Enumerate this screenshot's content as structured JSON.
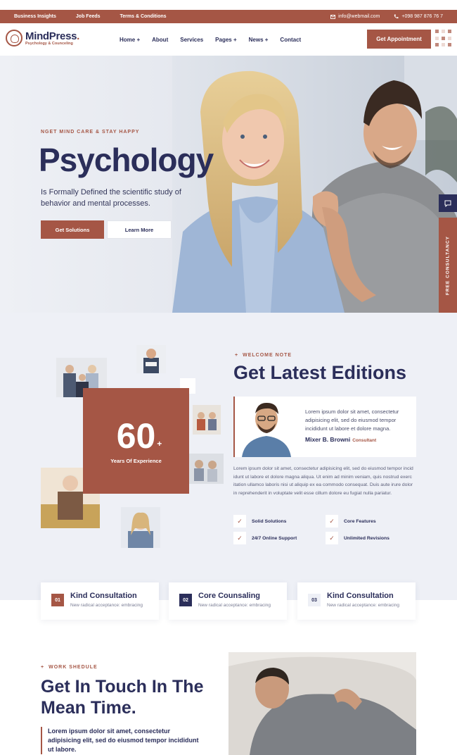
{
  "topbar": {
    "links": [
      "Business Insights",
      "Job Feeds",
      "Terms & Conditions"
    ],
    "email": "info@webmail.com",
    "phone": "+098 987 876 76 7"
  },
  "header": {
    "brand": "MindPress.",
    "brand_main": "MindPress",
    "brand_dot": ".",
    "tagline": "Psychology & Counceling",
    "nav": [
      "Home +",
      "About",
      "Services",
      "Pages +",
      "News +",
      "Contact"
    ],
    "cta": "Get Appointment"
  },
  "hero": {
    "kicker": "NGET MIND CARE & STAY HAPPY",
    "title": "Psychology",
    "subtitle": "Is Formally Defined the scientific study of behavior and mental processes.",
    "primary_button": "Get Solutions",
    "secondary_button": "Learn More",
    "side_tab": "FREE CONSULTANCY"
  },
  "about": {
    "experience_number": "60",
    "experience_plus": "+",
    "experience_label": "Years Of Experience",
    "kicker": "WELCOME NOTE",
    "title": "Get Latest Editions",
    "quote": "Lorem ipsum dolor sit amet, consectetur adipisicing elit, sed do eiusmod tempor incididunt ut labore et dolore magna.",
    "author": "Mixer B. Browni",
    "author_role": "Consultant",
    "body": "Lorem ipsum dolor sit amet, consectetur adipisicing elit, sed do eiusmod tempor incid idunt ut labore et dolore magna aliqua. Ut enim ad minim veniam, quis nostrud exerc itation ullamco laboris nisi ut aliquip ex ea commodo consequat. Duis aute irure dolor in reprehenderit in voluptate velit esse cillum dolore eu fugiat nulla pariatur.",
    "features": [
      "Solid Solutions",
      "Core Features",
      "24/7 Online Support",
      "Unlimited Revisions"
    ]
  },
  "services": [
    {
      "num": "01",
      "title": "Kind Consultation",
      "desc": "New radical acceptance: embracing",
      "color": "#a55645"
    },
    {
      "num": "02",
      "title": "Core Counsaling",
      "desc": "New radical acceptance: embracing",
      "color": "#2b2e5a"
    },
    {
      "num": "03",
      "title": "Kind Consultation",
      "desc": "New radical acceptance: embracing",
      "color": "#eef0f6"
    }
  ],
  "work": {
    "kicker": "WORK SHEDULE",
    "title": "Get In Touch In The Mean Time.",
    "subtitle": "Lorem ipsum dolor sit amet, consectetur adipisicing elit, sed do eiusmod tempor incididunt ut labore."
  },
  "icons": {
    "email": "envelope-icon",
    "phone": "phone-icon",
    "chat": "chat-icon",
    "check": "check-icon",
    "logo": "brain-logo-icon"
  },
  "colors": {
    "accent": "#a55645",
    "navy": "#2b2e5a",
    "section_bg": "#eef0f6"
  }
}
